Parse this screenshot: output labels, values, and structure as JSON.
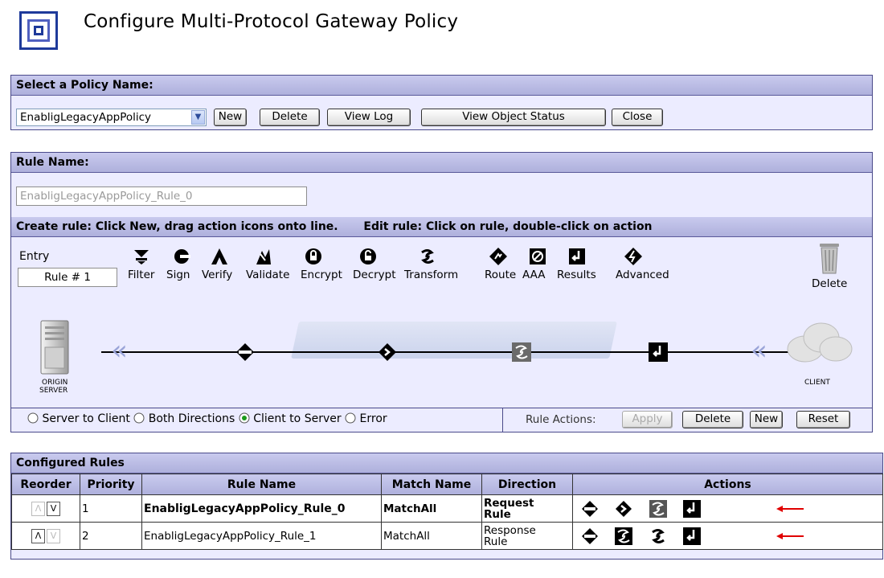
{
  "header": {
    "title": "Configure Multi-Protocol Gateway Policy"
  },
  "policy": {
    "section_title": "Select a Policy Name:",
    "selected": "EnabligLegacyAppPolicy",
    "buttons": {
      "new": "New",
      "delete": "Delete",
      "view_log": "View Log",
      "view_status": "View Object Status",
      "close": "Close"
    }
  },
  "rule": {
    "section_title": "Rule Name:",
    "name_value": "EnabligLegacyAppPolicy_Rule_0",
    "instructions_create": "Create rule: Click New, drag action icons onto line.",
    "instructions_edit": "Edit rule: Click on rule, double-click on action",
    "entry_label": "Entry",
    "entry_value": "Rule # 1",
    "palette": [
      "Filter",
      "Sign",
      "Verify",
      "Validate",
      "Encrypt",
      "Decrypt",
      "Transform",
      "Route",
      "AAA",
      "Results",
      "Advanced"
    ],
    "trash_label": "Delete",
    "server_label_1": "ORIGIN",
    "server_label_2": "SERVER",
    "client_label": "CLIENT",
    "directions": [
      "Server to Client",
      "Both Directions",
      "Client to Server",
      "Error"
    ],
    "selected_direction": "Client to Server",
    "actions_label": "Rule Actions:",
    "action_buttons": {
      "apply": "Apply",
      "delete": "Delete",
      "new": "New",
      "reset": "Reset"
    }
  },
  "configured": {
    "section_title": "Configured Rules",
    "columns": [
      "Reorder",
      "Priority",
      "Rule Name",
      "Match Name",
      "Direction",
      "Actions"
    ],
    "rows": [
      {
        "priority": "1",
        "name": "EnabligLegacyAppPolicy_Rule_0",
        "match": "MatchAll",
        "direction_1": "Request",
        "direction_2": "Rule",
        "actions": [
          "filter-icon",
          "route-icon",
          "transform-icon",
          "results-icon"
        ]
      },
      {
        "priority": "2",
        "name": "EnabligLegacyAppPolicy_Rule_1",
        "match": "MatchAll",
        "direction_1": "Response",
        "direction_2": "Rule",
        "actions": [
          "filter-icon",
          "transform-icon",
          "transform-swirl-icon",
          "results-icon"
        ]
      }
    ]
  },
  "colors": {
    "panel_bg": "#ececff",
    "header_bar": "#b8b9e4",
    "indicator_arrow": "#e00000"
  }
}
